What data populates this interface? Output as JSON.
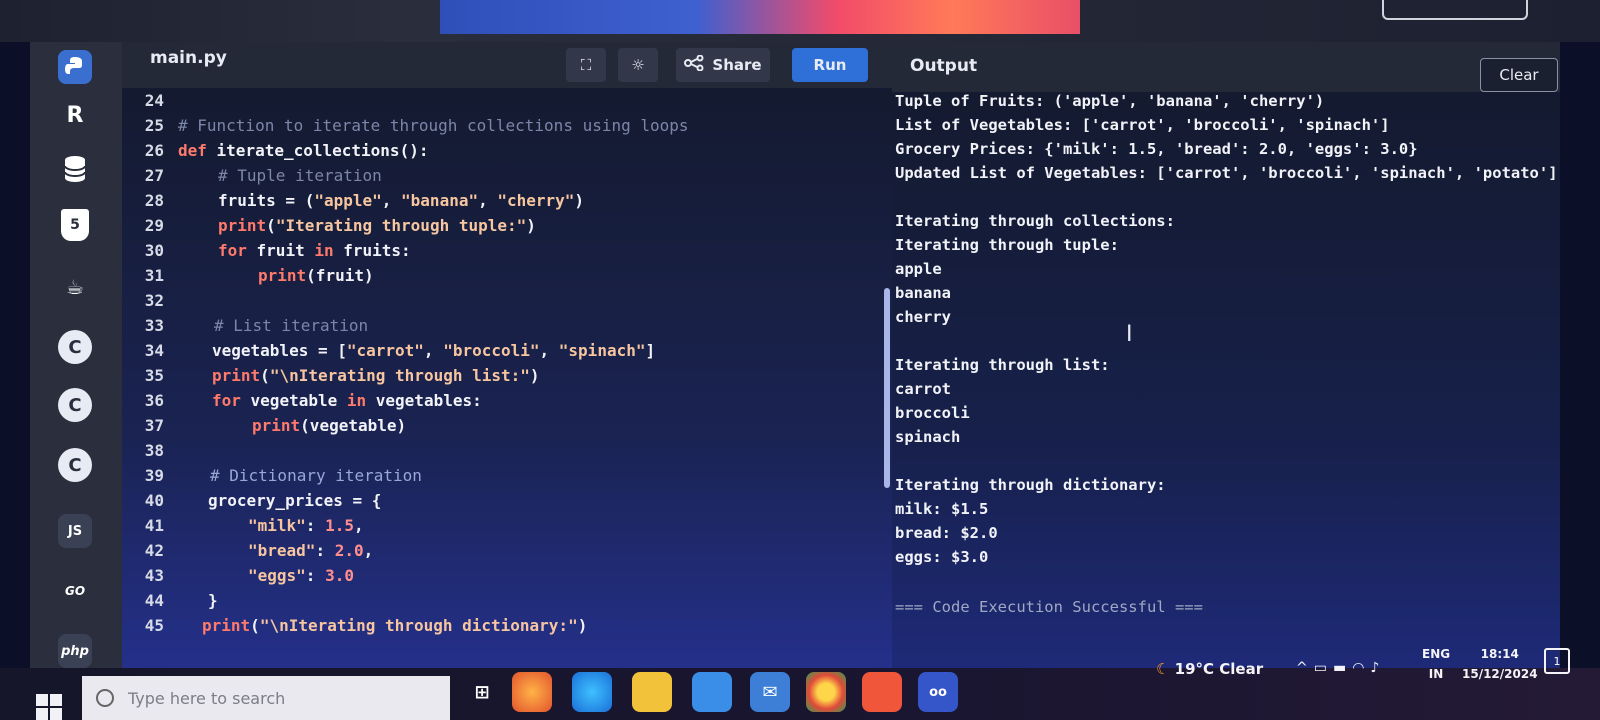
{
  "editor": {
    "filename": "main.py",
    "share_label": "Share",
    "run_label": "Run"
  },
  "sidebar": {
    "items": [
      {
        "icon": "python-icon",
        "label": ""
      },
      {
        "icon": "r-language-icon",
        "label": "R"
      },
      {
        "icon": "database-icon",
        "label": ""
      },
      {
        "icon": "html5-icon",
        "label": "5"
      },
      {
        "icon": "java-icon",
        "label": ""
      },
      {
        "icon": "c-language-icon",
        "label": "C"
      },
      {
        "icon": "cpp-icon",
        "label": "C"
      },
      {
        "icon": "csharp-icon",
        "label": "C"
      },
      {
        "icon": "javascript-icon",
        "label": "JS"
      },
      {
        "icon": "go-icon",
        "label": "GO"
      },
      {
        "icon": "php-icon",
        "label": "php"
      }
    ]
  },
  "code": {
    "lines": [
      {
        "n": "24"
      },
      {
        "n": "25"
      },
      {
        "n": "26"
      },
      {
        "n": "27"
      },
      {
        "n": "28"
      },
      {
        "n": "29"
      },
      {
        "n": "30"
      },
      {
        "n": "31"
      },
      {
        "n": "32"
      },
      {
        "n": "33"
      },
      {
        "n": "34"
      },
      {
        "n": "35"
      },
      {
        "n": "36"
      },
      {
        "n": "37"
      },
      {
        "n": "38"
      },
      {
        "n": "39"
      },
      {
        "n": "40"
      },
      {
        "n": "41"
      },
      {
        "n": "42"
      },
      {
        "n": "43"
      },
      {
        "n": "44"
      },
      {
        "n": "45"
      }
    ]
  },
  "output": {
    "title": "Output",
    "clear_label": "Clear",
    "lines": [
      "Tuple of Fruits: ('apple', 'banana', 'cherry')",
      "List of Vegetables: ['carrot', 'broccoli', 'spinach']",
      "Grocery Prices: {'milk': 1.5, 'bread': 2.0, 'eggs': 3.0}",
      "Updated List of Vegetables: ['carrot', 'broccoli', 'spinach', 'potato']",
      "",
      "Iterating through collections:",
      "Iterating through tuple:",
      "apple",
      "banana",
      "cherry",
      "",
      "Iterating through list:",
      "carrot",
      "broccoli",
      "spinach",
      "",
      "Iterating through dictionary:",
      "milk: $1.5",
      "bread: $2.0",
      "eggs: $3.0",
      "",
      "=== Code Execution Successful ==="
    ]
  },
  "taskbar": {
    "search_placeholder": "Type here to search",
    "weather": "19°C  Clear",
    "language_line1": "ENG",
    "language_line2": "IN",
    "time": "18:14",
    "date": "15/12/2024",
    "notification_count": "1",
    "apps": [
      "task-view-icon",
      "firefox-icon",
      "edge-icon",
      "file-explorer-icon",
      "store-icon",
      "mail-icon",
      "chrome-icon",
      "brave-icon",
      "app-icon"
    ]
  },
  "colors": {
    "run_button": "#2f6fd8",
    "keyword": "#ff7a6b",
    "string": "#f7c6a0",
    "comment": "#7c86a8"
  }
}
